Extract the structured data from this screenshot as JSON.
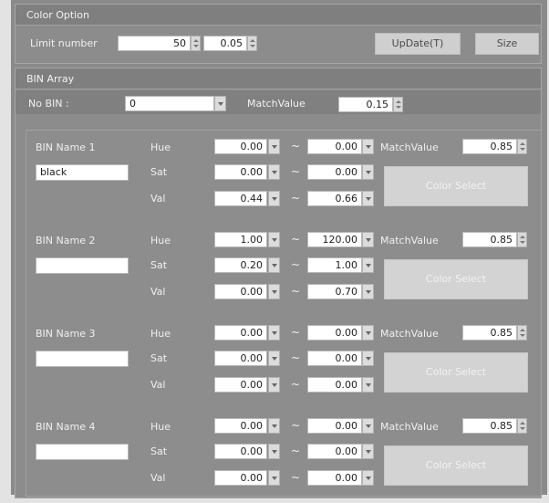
{
  "color_option": {
    "title": "Color Option",
    "limit_label": "Limit number",
    "limit_value": "50",
    "limit_step": "0.05",
    "update_button": "UpDate(T)",
    "size_button": "Size"
  },
  "bin_array": {
    "title": "BIN Array",
    "no_bin_label": "No BIN :",
    "no_bin_value": "0",
    "match_label": "MatchValue",
    "match_value": "0.15"
  },
  "common": {
    "hue_label": "Hue",
    "sat_label": "Sat",
    "val_label": "Val",
    "tilde": "~",
    "match_label": "MatchValue",
    "color_select": "Color Select"
  },
  "bins": [
    {
      "name": "BIN Name 1",
      "text": "black",
      "hue_min": "0.00",
      "hue_max": "0.00",
      "sat_min": "0.00",
      "sat_max": "0.00",
      "val_min": "0.44",
      "val_max": "0.66",
      "match": "0.85"
    },
    {
      "name": "BIN Name 2",
      "text": "",
      "hue_min": "1.00",
      "hue_max": "120.00",
      "sat_min": "0.20",
      "sat_max": "1.00",
      "val_min": "0.00",
      "val_max": "0.70",
      "match": "0.85"
    },
    {
      "name": "BIN Name 3",
      "text": "",
      "hue_min": "0.00",
      "hue_max": "0.00",
      "sat_min": "0.00",
      "sat_max": "0.00",
      "val_min": "0.00",
      "val_max": "0.00",
      "match": "0.85"
    },
    {
      "name": "BIN Name 4",
      "text": "",
      "hue_min": "0.00",
      "hue_max": "0.00",
      "sat_min": "0.00",
      "sat_max": "0.00",
      "val_min": "0.00",
      "val_max": "0.00",
      "match": "0.85"
    }
  ]
}
